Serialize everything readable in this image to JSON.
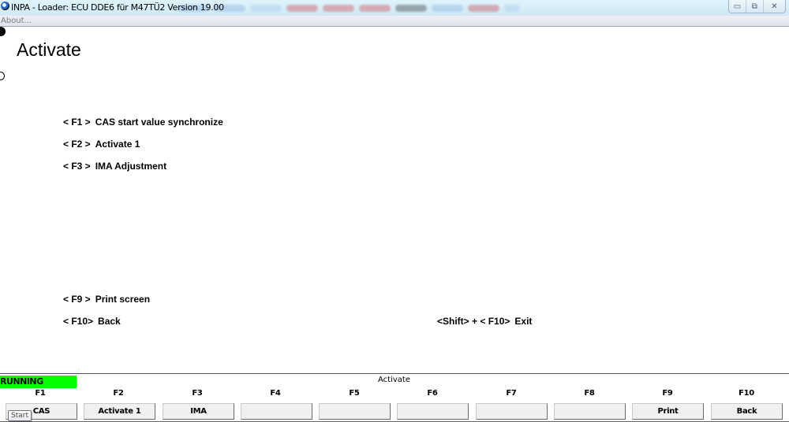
{
  "window": {
    "title": "INPA - Loader:  ECU DDE6 für M47TÜ2 Version 19.00",
    "controls": {
      "minimize": "▭",
      "maximize": "⧉",
      "close": "✕"
    }
  },
  "menubar": {
    "about": "About..."
  },
  "page": {
    "title": "Activate"
  },
  "menu_items": [
    {
      "key": "< F1 >",
      "label": "CAS start value synchronize"
    },
    {
      "key": "< F2 >",
      "label": "Activate 1"
    },
    {
      "key": "< F3 >",
      "label": "IMA Adjustment"
    },
    {
      "key": "< F9 >",
      "label": "Print screen"
    },
    {
      "key": "< F10>",
      "label": "Back"
    }
  ],
  "exit_hint": {
    "key": "<Shift> + < F10>",
    "label": "Exit"
  },
  "status": {
    "state": "RUNNING",
    "state_color": "#00ff00",
    "screen_name": "Activate"
  },
  "fkeys": [
    {
      "key": "F1",
      "label": "CAS"
    },
    {
      "key": "F2",
      "label": "Activate 1"
    },
    {
      "key": "F3",
      "label": "IMA"
    },
    {
      "key": "F4",
      "label": ""
    },
    {
      "key": "F5",
      "label": ""
    },
    {
      "key": "F6",
      "label": ""
    },
    {
      "key": "F7",
      "label": ""
    },
    {
      "key": "F8",
      "label": ""
    },
    {
      "key": "F9",
      "label": "Print"
    },
    {
      "key": "F10",
      "label": "Back"
    }
  ],
  "tooltip": {
    "text": "Start"
  }
}
